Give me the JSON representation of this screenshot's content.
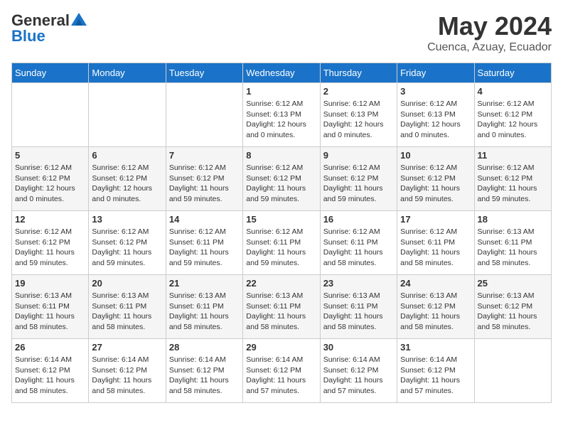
{
  "header": {
    "logo_general": "General",
    "logo_blue": "Blue",
    "month": "May 2024",
    "location": "Cuenca, Azuay, Ecuador"
  },
  "days_of_week": [
    "Sunday",
    "Monday",
    "Tuesday",
    "Wednesday",
    "Thursday",
    "Friday",
    "Saturday"
  ],
  "weeks": [
    {
      "cells": [
        {
          "day": "",
          "info": ""
        },
        {
          "day": "",
          "info": ""
        },
        {
          "day": "",
          "info": ""
        },
        {
          "day": "1",
          "info": "Sunrise: 6:12 AM\nSunset: 6:13 PM\nDaylight: 12 hours\nand 0 minutes."
        },
        {
          "day": "2",
          "info": "Sunrise: 6:12 AM\nSunset: 6:13 PM\nDaylight: 12 hours\nand 0 minutes."
        },
        {
          "day": "3",
          "info": "Sunrise: 6:12 AM\nSunset: 6:13 PM\nDaylight: 12 hours\nand 0 minutes."
        },
        {
          "day": "4",
          "info": "Sunrise: 6:12 AM\nSunset: 6:12 PM\nDaylight: 12 hours\nand 0 minutes."
        }
      ]
    },
    {
      "cells": [
        {
          "day": "5",
          "info": "Sunrise: 6:12 AM\nSunset: 6:12 PM\nDaylight: 12 hours\nand 0 minutes."
        },
        {
          "day": "6",
          "info": "Sunrise: 6:12 AM\nSunset: 6:12 PM\nDaylight: 12 hours\nand 0 minutes."
        },
        {
          "day": "7",
          "info": "Sunrise: 6:12 AM\nSunset: 6:12 PM\nDaylight: 11 hours\nand 59 minutes."
        },
        {
          "day": "8",
          "info": "Sunrise: 6:12 AM\nSunset: 6:12 PM\nDaylight: 11 hours\nand 59 minutes."
        },
        {
          "day": "9",
          "info": "Sunrise: 6:12 AM\nSunset: 6:12 PM\nDaylight: 11 hours\nand 59 minutes."
        },
        {
          "day": "10",
          "info": "Sunrise: 6:12 AM\nSunset: 6:12 PM\nDaylight: 11 hours\nand 59 minutes."
        },
        {
          "day": "11",
          "info": "Sunrise: 6:12 AM\nSunset: 6:12 PM\nDaylight: 11 hours\nand 59 minutes."
        }
      ]
    },
    {
      "cells": [
        {
          "day": "12",
          "info": "Sunrise: 6:12 AM\nSunset: 6:12 PM\nDaylight: 11 hours\nand 59 minutes."
        },
        {
          "day": "13",
          "info": "Sunrise: 6:12 AM\nSunset: 6:12 PM\nDaylight: 11 hours\nand 59 minutes."
        },
        {
          "day": "14",
          "info": "Sunrise: 6:12 AM\nSunset: 6:11 PM\nDaylight: 11 hours\nand 59 minutes."
        },
        {
          "day": "15",
          "info": "Sunrise: 6:12 AM\nSunset: 6:11 PM\nDaylight: 11 hours\nand 59 minutes."
        },
        {
          "day": "16",
          "info": "Sunrise: 6:12 AM\nSunset: 6:11 PM\nDaylight: 11 hours\nand 58 minutes."
        },
        {
          "day": "17",
          "info": "Sunrise: 6:12 AM\nSunset: 6:11 PM\nDaylight: 11 hours\nand 58 minutes."
        },
        {
          "day": "18",
          "info": "Sunrise: 6:13 AM\nSunset: 6:11 PM\nDaylight: 11 hours\nand 58 minutes."
        }
      ]
    },
    {
      "cells": [
        {
          "day": "19",
          "info": "Sunrise: 6:13 AM\nSunset: 6:11 PM\nDaylight: 11 hours\nand 58 minutes."
        },
        {
          "day": "20",
          "info": "Sunrise: 6:13 AM\nSunset: 6:11 PM\nDaylight: 11 hours\nand 58 minutes."
        },
        {
          "day": "21",
          "info": "Sunrise: 6:13 AM\nSunset: 6:11 PM\nDaylight: 11 hours\nand 58 minutes."
        },
        {
          "day": "22",
          "info": "Sunrise: 6:13 AM\nSunset: 6:11 PM\nDaylight: 11 hours\nand 58 minutes."
        },
        {
          "day": "23",
          "info": "Sunrise: 6:13 AM\nSunset: 6:11 PM\nDaylight: 11 hours\nand 58 minutes."
        },
        {
          "day": "24",
          "info": "Sunrise: 6:13 AM\nSunset: 6:12 PM\nDaylight: 11 hours\nand 58 minutes."
        },
        {
          "day": "25",
          "info": "Sunrise: 6:13 AM\nSunset: 6:12 PM\nDaylight: 11 hours\nand 58 minutes."
        }
      ]
    },
    {
      "cells": [
        {
          "day": "26",
          "info": "Sunrise: 6:14 AM\nSunset: 6:12 PM\nDaylight: 11 hours\nand 58 minutes."
        },
        {
          "day": "27",
          "info": "Sunrise: 6:14 AM\nSunset: 6:12 PM\nDaylight: 11 hours\nand 58 minutes."
        },
        {
          "day": "28",
          "info": "Sunrise: 6:14 AM\nSunset: 6:12 PM\nDaylight: 11 hours\nand 58 minutes."
        },
        {
          "day": "29",
          "info": "Sunrise: 6:14 AM\nSunset: 6:12 PM\nDaylight: 11 hours\nand 57 minutes."
        },
        {
          "day": "30",
          "info": "Sunrise: 6:14 AM\nSunset: 6:12 PM\nDaylight: 11 hours\nand 57 minutes."
        },
        {
          "day": "31",
          "info": "Sunrise: 6:14 AM\nSunset: 6:12 PM\nDaylight: 11 hours\nand 57 minutes."
        },
        {
          "day": "",
          "info": ""
        }
      ]
    }
  ]
}
